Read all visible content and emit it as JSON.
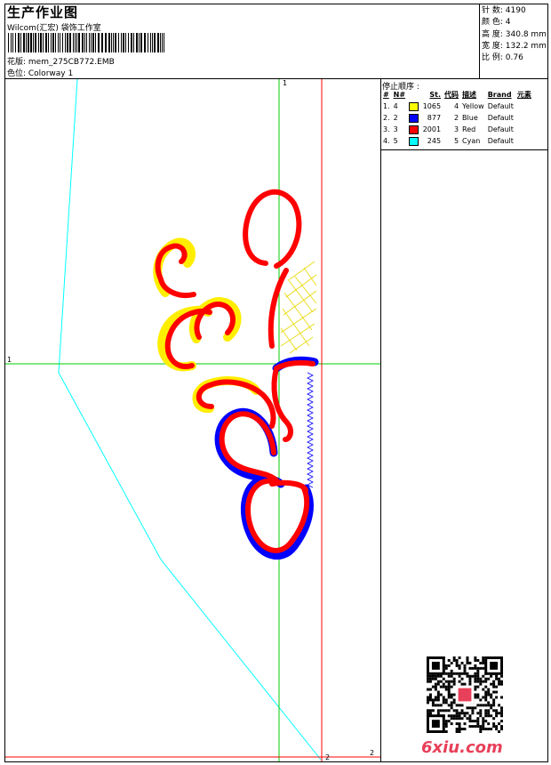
{
  "header": {
    "title": "生产作业图",
    "company": "Wilcom(汇宏) 袋饰工作室",
    "design": "花版: mem_275CB772.EMB",
    "colorway": "色位: Colorway 1"
  },
  "stats": [
    {
      "label": "针 数:",
      "value": "4190"
    },
    {
      "label": "颜 色:",
      "value": "4"
    },
    {
      "label": "高 度:",
      "value": "340.8 mm"
    },
    {
      "label": "宽 度:",
      "value": "132.2 mm"
    },
    {
      "label": "比 例:",
      "value": "0.76"
    }
  ],
  "sequence": {
    "title": "停止顺序 :",
    "headers": [
      "#",
      "N#",
      "St.",
      "代码",
      "描述",
      "Brand",
      "元素"
    ],
    "rows": [
      {
        "idx": "1.",
        "n": "4",
        "color": "#ffff00",
        "st": "1065",
        "code": "4",
        "desc": "Yellow",
        "brand": "Default"
      },
      {
        "idx": "2.",
        "n": "2",
        "color": "#0000ff",
        "st": "877",
        "code": "2",
        "desc": "Blue",
        "brand": "Default"
      },
      {
        "idx": "3.",
        "n": "3",
        "color": "#ff0000",
        "st": "2001",
        "code": "3",
        "desc": "Red",
        "brand": "Default"
      },
      {
        "idx": "4.",
        "n": "5",
        "color": "#00ffff",
        "st": "245",
        "code": "5",
        "desc": "Cyan",
        "brand": "Default"
      }
    ]
  },
  "guides": {
    "top": "1",
    "left": "1",
    "bottom_a": "2",
    "bottom_b": "2"
  },
  "watermark": "6xiu.com",
  "colors": {
    "yellow": "#ffff00",
    "blue": "#0000ff",
    "red": "#ff0000",
    "cyan": "#00ffff",
    "guide_green": "#00cc00",
    "guide_red": "#ff0000"
  }
}
